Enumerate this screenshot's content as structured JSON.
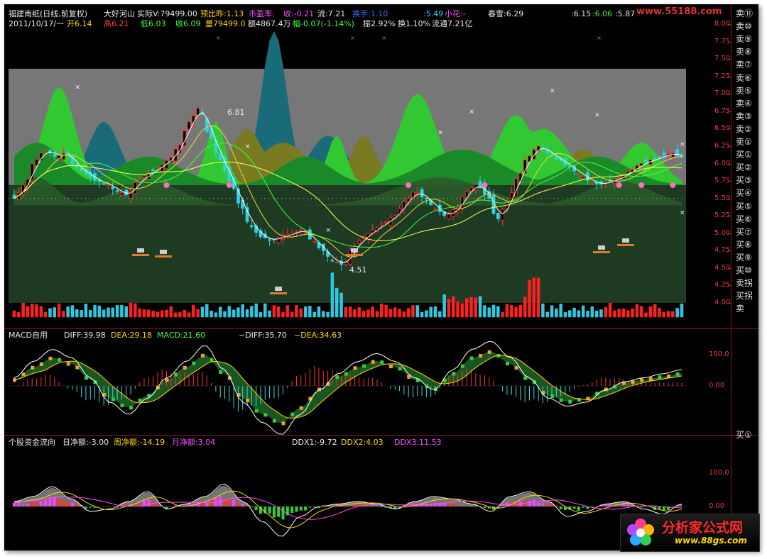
{
  "header": {
    "line1": [
      {
        "t": "福建南纸(日线,前复权)",
        "c": "#e8e8e8"
      },
      {
        "t": "大好河山",
        "c": "#e8e8e8"
      },
      {
        "t": "实际V:79499.00",
        "c": "#e8e8e8"
      },
      {
        "t": "预比昨:1.13",
        "c": "#ffd800"
      },
      {
        "t": "市盈率:",
        "c": "#ff50ff"
      },
      {
        "t": "收:-0.21",
        "c": "#ff50ff"
      },
      {
        "t": "流:7.21",
        "c": "#e8e8e8"
      },
      {
        "t": "换手:1.10",
        "c": "#3a6bff"
      },
      {
        "t": ":5.49",
        "c": "#40d0ff"
      },
      {
        "t": "小花:-",
        "c": "#ff50ff"
      },
      {
        "t": "春雪:6.29",
        "c": "#e8e8e8"
      },
      {
        "t": ":6.15",
        "c": "#e8e8e8"
      },
      {
        "t": ":6.06",
        "c": "#40ff40"
      },
      {
        "t": ":5.87",
        "c": "#e8e8e8"
      }
    ],
    "line2": [
      {
        "t": "2011/10/17/一",
        "c": "#e8e8e8"
      },
      {
        "t": "开6.14",
        "c": "#ffd800"
      },
      {
        "t": "高6.21",
        "c": "#ff4040"
      },
      {
        "t": "低6.03",
        "c": "#40ff40"
      },
      {
        "t": "收6.09",
        "c": "#40ff40"
      },
      {
        "t": "量79499.0",
        "c": "#ffd800"
      },
      {
        "t": "额4867.4万",
        "c": "#e8e8e8"
      },
      {
        "t": "幅-0.07(-1.14%)",
        "c": "#40ff40"
      },
      {
        "t": "振2.92%",
        "c": "#e8e8e8"
      },
      {
        "t": "换1.10%",
        "c": "#e8e8e8"
      },
      {
        "t": "流通7.21亿",
        "c": "#e8e8e8"
      }
    ],
    "brand": "www.55188.com"
  },
  "price_axis": [
    "8.00",
    "7.75",
    "7.50",
    "7.25",
    "7.00",
    "6.75",
    "6.50",
    "6.25",
    "6.00",
    "5.75",
    "5.50",
    "5.25",
    "5.00",
    "4.75",
    "4.50",
    "4.25",
    "4.00"
  ],
  "annotations": {
    "high": "6.81",
    "low": "4.51"
  },
  "macd_panel": {
    "items": [
      {
        "t": "MACD自用",
        "c": "#e8e8e8"
      },
      {
        "t": "DIFF:39.98",
        "c": "#e8e8e8"
      },
      {
        "t": "DEA:29.18",
        "c": "#ffd800"
      },
      {
        "t": "MACD:21.60",
        "c": "#40ff40"
      },
      {
        "t": "~DIFF:35.70",
        "c": "#e8e8e8"
      },
      {
        "t": "~DEA:34.63",
        "c": "#ffd800"
      }
    ],
    "axis": [
      "100.0",
      "0.00"
    ]
  },
  "flow_panel": {
    "items": [
      {
        "t": "个股资金流向",
        "c": "#e8e8e8"
      },
      {
        "t": "日净额:-3.00",
        "c": "#e8e8e8"
      },
      {
        "t": "周净额:-14.19",
        "c": "#ffd800"
      },
      {
        "t": "月净额:3.04",
        "c": "#ff50ff"
      },
      {
        "t": "DDX1:-9.72",
        "c": "#e8e8e8"
      },
      {
        "t": "DDX2:4.03",
        "c": "#ffd800"
      },
      {
        "t": "DDX3:11.53",
        "c": "#ff50ff"
      }
    ],
    "axis": [
      "100.0",
      "0.00"
    ]
  },
  "side_signals": [
    "卖⑪",
    "卖⑩",
    "卖⑨",
    "卖⑧",
    "卖⑦",
    "卖⑥",
    "卖⑤",
    "卖④",
    "卖③",
    "卖②",
    "卖①",
    "买①",
    "买②",
    "买③",
    "买④",
    "买⑤",
    "买⑥",
    "买⑦",
    "买⑧",
    "买⑨",
    "买⑩",
    "卖拐",
    "买拐",
    "卖"
  ],
  "flow_side_signal": "买①",
  "watermark": {
    "name": "分析家公式网",
    "url": "www.88gs.com"
  },
  "chart_data": [
    {
      "type": "candlestick",
      "title": "福建南纸(日线,前复权)",
      "ylim": [
        4.0,
        8.0
      ],
      "ohlc_sample_last": {
        "open": 6.14,
        "high": 6.21,
        "low": 6.03,
        "close": 6.09
      },
      "close_path": [
        5.5,
        5.7,
        6.05,
        6.2,
        6.1,
        6.15,
        5.95,
        5.85,
        5.75,
        5.7,
        5.6,
        5.55,
        5.75,
        5.85,
        5.95,
        6.05,
        6.25,
        6.6,
        6.8,
        6.4,
        6.05,
        5.75,
        5.4,
        5.1,
        4.95,
        4.9,
        4.95,
        5.0,
        5.05,
        4.9,
        4.75,
        4.6,
        4.55,
        4.8,
        4.95,
        5.05,
        5.15,
        5.25,
        5.45,
        5.6,
        5.5,
        5.35,
        5.25,
        5.35,
        5.6,
        5.7,
        5.55,
        5.2,
        5.45,
        5.8,
        6.1,
        6.25,
        6.15,
        6.05,
        5.95,
        5.85,
        5.75,
        5.7,
        5.75,
        5.8,
        5.9,
        6.0,
        6.05,
        6.1,
        6.15,
        6.09
      ],
      "annotations": {
        "high": 6.81,
        "low": 4.51
      }
    },
    {
      "type": "line",
      "title": "MACD自用",
      "series": [
        {
          "name": "DIFF",
          "last": 39.98
        },
        {
          "name": "DEA",
          "last": 29.18
        },
        {
          "name": "MACD",
          "last": 21.6
        }
      ],
      "axis_ticks": [
        100.0,
        0.0
      ]
    },
    {
      "type": "line",
      "title": "个股资金流向",
      "series": [
        {
          "name": "日净额",
          "last": -3.0
        },
        {
          "name": "周净额",
          "last": -14.19
        },
        {
          "name": "月净额",
          "last": 3.04
        },
        {
          "name": "DDX1",
          "last": -9.72
        },
        {
          "name": "DDX2",
          "last": 4.03
        },
        {
          "name": "DDX3",
          "last": 11.53
        }
      ],
      "axis_ticks": [
        100.0,
        0.0
      ]
    }
  ]
}
